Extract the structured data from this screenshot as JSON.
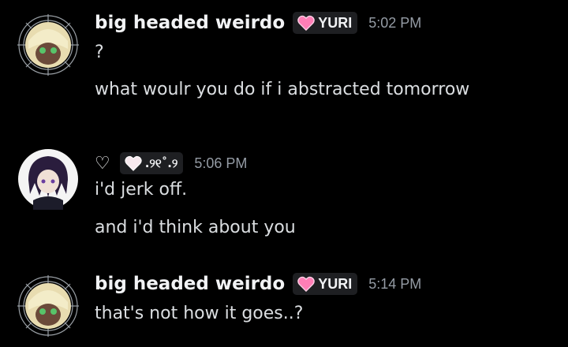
{
  "messages": [
    {
      "username": "big headed weirdo",
      "tag": "YURI",
      "time": "5:02 PM",
      "lines": [
        "?",
        "what woulr you do if i abstracted tomorrow"
      ]
    },
    {
      "username_glyph": "♡",
      "tag_text": ".୨୧˚.୨",
      "time": "5:06 PM",
      "lines": [
        "i'd jerk off.",
        "and i'd think about you"
      ]
    },
    {
      "username": "big headed weirdo",
      "tag": "YURI",
      "time": "5:14 PM",
      "lines": [
        "that's not how it goes..?"
      ]
    }
  ],
  "colors": {
    "background": "#000000",
    "username": "#f2f3f5",
    "message_text": "#dbdee1",
    "timestamp": "#949ba4",
    "tag_bg": "#1e1f22",
    "heart_pink": "#ff7eb6"
  }
}
